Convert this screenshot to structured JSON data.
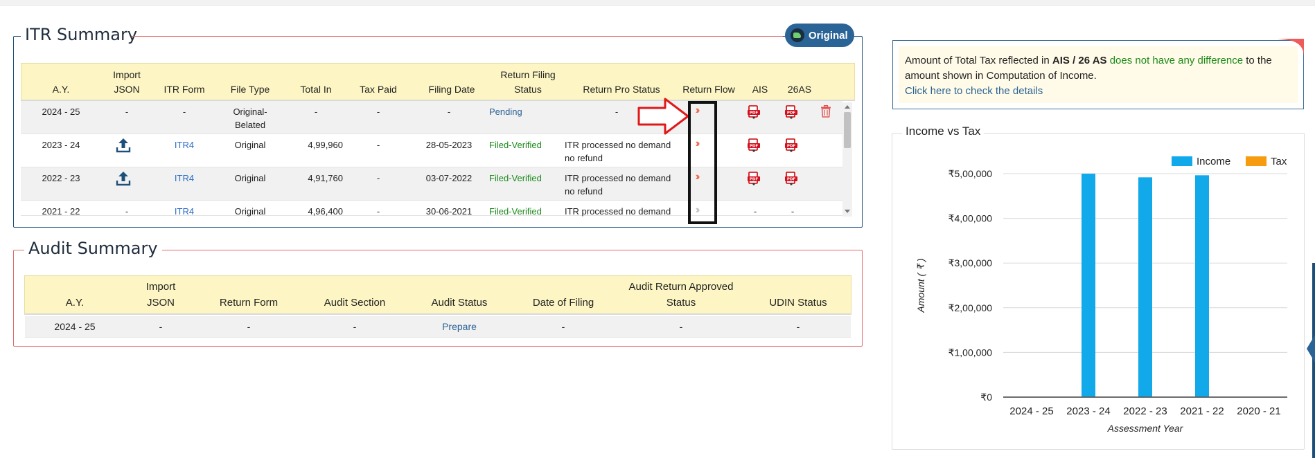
{
  "itr": {
    "title": "ITR Summary",
    "badge": "Original",
    "headers": [
      {
        "l1": "",
        "l2": "A.Y."
      },
      {
        "l1": "Import",
        "l2": "JSON"
      },
      {
        "l1": "",
        "l2": "ITR Form"
      },
      {
        "l1": "",
        "l2": "File Type"
      },
      {
        "l1": "",
        "l2": "Total In"
      },
      {
        "l1": "",
        "l2": "Tax Paid"
      },
      {
        "l1": "",
        "l2": "Filing Date"
      },
      {
        "l1": "Return Filing",
        "l2": "Status"
      },
      {
        "l1": "",
        "l2": "Return Pro Status"
      },
      {
        "l1": "",
        "l2": "Return Flow"
      },
      {
        "l1": "",
        "l2": "AIS"
      },
      {
        "l1": "",
        "l2": "26AS"
      }
    ],
    "rows": [
      {
        "ay": "2024 - 25",
        "json": "-",
        "form": "-",
        "type1": "Original-",
        "type2": "Belated",
        "total": "-",
        "tax": "-",
        "date": "-",
        "status": "Pending",
        "pro1": "-",
        "pro2": ""
      },
      {
        "ay": "2023 - 24",
        "json": "upload",
        "form": "ITR4",
        "type1": "Original",
        "type2": "",
        "total": "4,99,960",
        "tax": "-",
        "date": "28-05-2023",
        "status": "Filed-Verified",
        "pro1": "ITR processed no demand",
        "pro2": "no refund"
      },
      {
        "ay": "2022 - 23",
        "json": "upload",
        "form": "ITR4",
        "type1": "Original",
        "type2": "",
        "total": "4,91,760",
        "tax": "-",
        "date": "03-07-2022",
        "status": "Filed-Verified",
        "pro1": "ITR processed no demand",
        "pro2": "no refund"
      },
      {
        "ay": "2021 - 22",
        "json": "-",
        "form": "ITR4",
        "type1": "Original",
        "type2": "",
        "total": "4,96,400",
        "tax": "-",
        "date": "30-06-2021",
        "status": "Filed-Verified",
        "pro1": "ITR processed no demand",
        "pro2": "",
        "ais": "-",
        "as26": "-"
      }
    ]
  },
  "audit": {
    "title": "Audit Summary",
    "headers": [
      {
        "l1": "",
        "l2": "A.Y."
      },
      {
        "l1": "Import",
        "l2": "JSON"
      },
      {
        "l1": "",
        "l2": "Return Form"
      },
      {
        "l1": "",
        "l2": "Audit Section"
      },
      {
        "l1": "",
        "l2": "Audit Status"
      },
      {
        "l1": "",
        "l2": "Date of Filing"
      },
      {
        "l1": "Audit Return Approved",
        "l2": "Status"
      },
      {
        "l1": "",
        "l2": "UDIN Status"
      }
    ],
    "rows": [
      {
        "ay": "2024 - 25",
        "json": "-",
        "form": "-",
        "section": "-",
        "status": "Prepare",
        "date": "-",
        "approved": "-",
        "udin": "-"
      }
    ]
  },
  "notice": {
    "p1": "Amount of Total Tax reflected in ",
    "b1": "AIS / 26 AS",
    "g1": " does not have any difference",
    "p2": " to the amount shown in Computation of Income.",
    "link": "Click here to check the details"
  },
  "colors": {
    "income": "#12a9ea",
    "tax": "#f59c10",
    "accent": "#2a6396",
    "arrow": "#e01818"
  },
  "chart_data": {
    "type": "bar",
    "title": "Income vs Tax",
    "xlabel": "Assessment Year",
    "ylabel": "Amount ( ₹ )",
    "categories": [
      "2024 - 25",
      "2023 - 24",
      "2022 - 23",
      "2021 - 22",
      "2020 - 21"
    ],
    "series": [
      {
        "name": "Income",
        "values": [
          0,
          499960,
          491760,
          496400,
          0
        ]
      },
      {
        "name": "Tax",
        "values": [
          0,
          0,
          0,
          0,
          0
        ]
      }
    ],
    "ylim": [
      0,
      500000
    ],
    "yticks": [
      "₹0",
      "₹1,00,000",
      "₹2,00,000",
      "₹3,00,000",
      "₹4,00,000",
      "₹5,00,000"
    ],
    "legend": "top-right",
    "grid": true
  }
}
